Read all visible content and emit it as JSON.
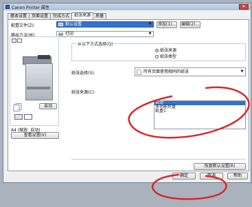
{
  "window": {
    "title": "Canon Printer 属性",
    "close_glyph": "✕"
  },
  "tabs": [
    "基本设置",
    "页面设置",
    "完成方式",
    "纸张来源",
    "质量"
  ],
  "active_tab_index": 3,
  "profile": {
    "label": "配置文件(Z):",
    "value": "默认设置",
    "add_button": "添加(1)...",
    "edit_button": "编辑(2)..."
  },
  "output": {
    "label": "输出方法(M):",
    "value": "打印"
  },
  "preview": {
    "status": "A4 (缩放: 自动)",
    "auto_button": "自动",
    "view_settings_button": "查看设置(V)"
  },
  "source_select": {
    "group_label": "从以下方式选择(Q)",
    "option_source": "纸张来源",
    "option_type": "纸张类型",
    "selected": "纸张来源"
  },
  "paper_selection": {
    "label": "纸张选择(S):",
    "value": "所有页面使用相同的纸张"
  },
  "paper_source": {
    "label": "纸张来源(C):",
    "items": [
      "自动",
      "多功能托盘",
      "纸盒1"
    ],
    "selected_index": 0
  },
  "restore_defaults_button": "恢复默认设置(R)",
  "footer": {
    "ok": "确定",
    "cancel": "取消",
    "help": "帮助"
  },
  "colors": {
    "selection": "#3471c9",
    "annotation_red": "#d9262a"
  },
  "icons": [
    "printer-app-icon",
    "dropdown-arrow-icon",
    "document-icon",
    "printer-icon",
    "pages-icon"
  ]
}
